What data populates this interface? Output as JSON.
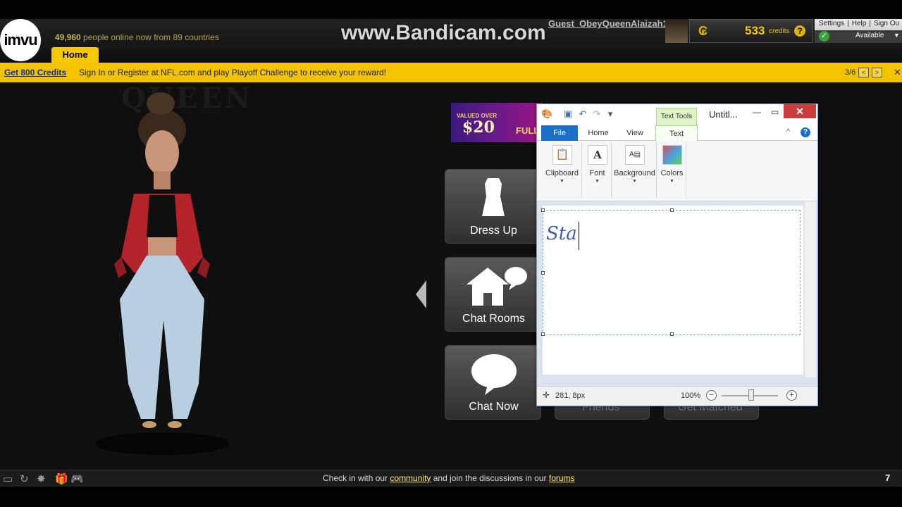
{
  "header": {
    "logo_text": "imvu",
    "online_count": "49,960",
    "online_text": "people online now from 89 countries",
    "watermark": "www.Bandicam.com",
    "username": "Guest_ObeyQueenAlaizah1",
    "credit_symbol": "₢",
    "credits": "533",
    "credits_label": "credits",
    "help_glyph": "?",
    "account_links": [
      "Settings",
      "|",
      "Help",
      "|",
      "Sign Ou"
    ],
    "status": "Available",
    "home_tab": "Home"
  },
  "promo": {
    "link_text": "Get 800 Credits",
    "message": "Sign In or Register at NFL.com and play Playoff Challenge to receive your reward!",
    "page": "3/6",
    "prev": "<",
    "next": ">",
    "close": "✕"
  },
  "main": {
    "background_text": "QUEEN",
    "ad": {
      "valued": "VALUED OVER",
      "price": "$20",
      "tail": "FULL"
    },
    "tiles": [
      {
        "label": "Dress Up",
        "icon": "dress-form-icon"
      },
      {
        "label": "Chat Rooms",
        "icon": "house-chat-icon"
      },
      {
        "label": "Chat Now",
        "icon": "speech-bubble-icon"
      }
    ],
    "hidden_tiles": [
      "Friends",
      "Get Matched"
    ]
  },
  "paint": {
    "text_tools": "Text Tools",
    "title": "Untitl...",
    "tabs": [
      "File",
      "Home",
      "View",
      "Text"
    ],
    "groups": [
      "Clipboard",
      "Font",
      "Background",
      "Colors"
    ],
    "typed_text": "Sta",
    "coords": "281, 8px",
    "zoom": "100%"
  },
  "footer": {
    "prefix": "Check in with our",
    "community": "community",
    "middle": "and join the discussions in our",
    "forums": "forums",
    "count": "7"
  },
  "colors": {
    "accent_yellow": "#f3c300",
    "link_blue": "#0a2ea0",
    "paint_file_blue": "#1c6fc7",
    "close_red": "#c83c3c"
  }
}
